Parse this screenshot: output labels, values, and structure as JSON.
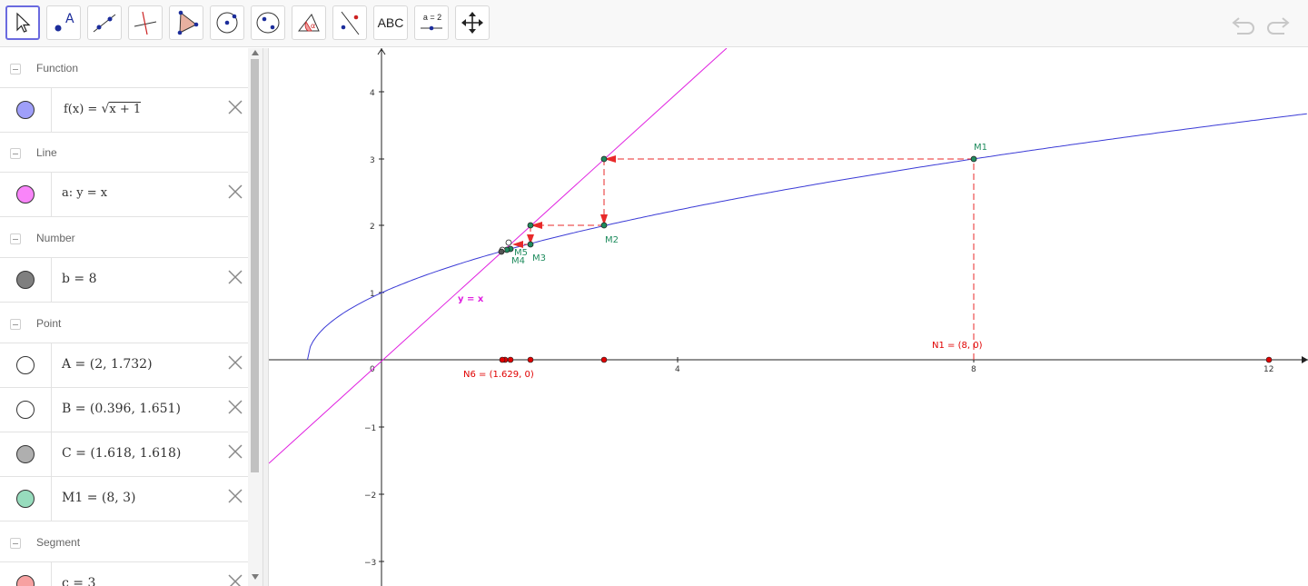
{
  "toolbar": {
    "tools": [
      {
        "name": "move-tool",
        "selected": true
      },
      {
        "name": "point-tool",
        "selected": false
      },
      {
        "name": "line-tool",
        "selected": false
      },
      {
        "name": "perpendicular-line-tool",
        "selected": false
      },
      {
        "name": "polygon-tool",
        "selected": false
      },
      {
        "name": "circle-tool",
        "selected": false
      },
      {
        "name": "ellipse-tool",
        "selected": false
      },
      {
        "name": "angle-tool",
        "selected": false
      },
      {
        "name": "reflect-tool",
        "selected": false
      },
      {
        "name": "text-tool",
        "selected": false
      },
      {
        "name": "slider-tool",
        "selected": false
      },
      {
        "name": "move-graphics-view-tool",
        "selected": false
      }
    ],
    "text_tool_label": "ABC",
    "slider_tool_label": "a = 2"
  },
  "algebra": {
    "function": {
      "header": "Function",
      "expr_prefix": "f(x) = ",
      "expr_radicand": "x + 1",
      "color": "#9f9ff9"
    },
    "line": {
      "header": "Line",
      "expr": "a: y = x",
      "color": "#f985f9"
    },
    "number": {
      "header": "Number",
      "expr": "b = 8",
      "color": "#7f7f7f"
    },
    "point": {
      "header": "Point",
      "items": [
        {
          "expr": "A = (2, 1.732)",
          "color": "#ffffff"
        },
        {
          "expr": "B = (0.396, 1.651)",
          "color": "#ffffff"
        },
        {
          "expr": "C = (1.618, 1.618)",
          "color": "#afafaf"
        },
        {
          "expr": "M1 = (8, 3)",
          "color": "#97dcbd"
        }
      ]
    },
    "segment": {
      "header": "Segment",
      "expr": "c = 3",
      "color": "#f7a1a1"
    }
  },
  "graph": {
    "axis_x_ticks": [
      "0",
      "4",
      "8",
      "12"
    ],
    "axis_y_ticks": [
      "4",
      "3",
      "2",
      "1",
      "−1",
      "−2",
      "−3"
    ],
    "line_label": "y = x",
    "points_labels": {
      "M1": "M1",
      "M2": "M2",
      "M3": "M3",
      "M4": "M4",
      "M5": "M5"
    },
    "n1_label": "N1 = (8, 0)",
    "n6_label": "N6 = (1.629, 0)",
    "colors": {
      "function": "#3b3bd6",
      "line": "#e020e0",
      "cobweb": "#e82a2a",
      "point_green": "#1f8c5e",
      "point_red": "#e00000"
    }
  }
}
